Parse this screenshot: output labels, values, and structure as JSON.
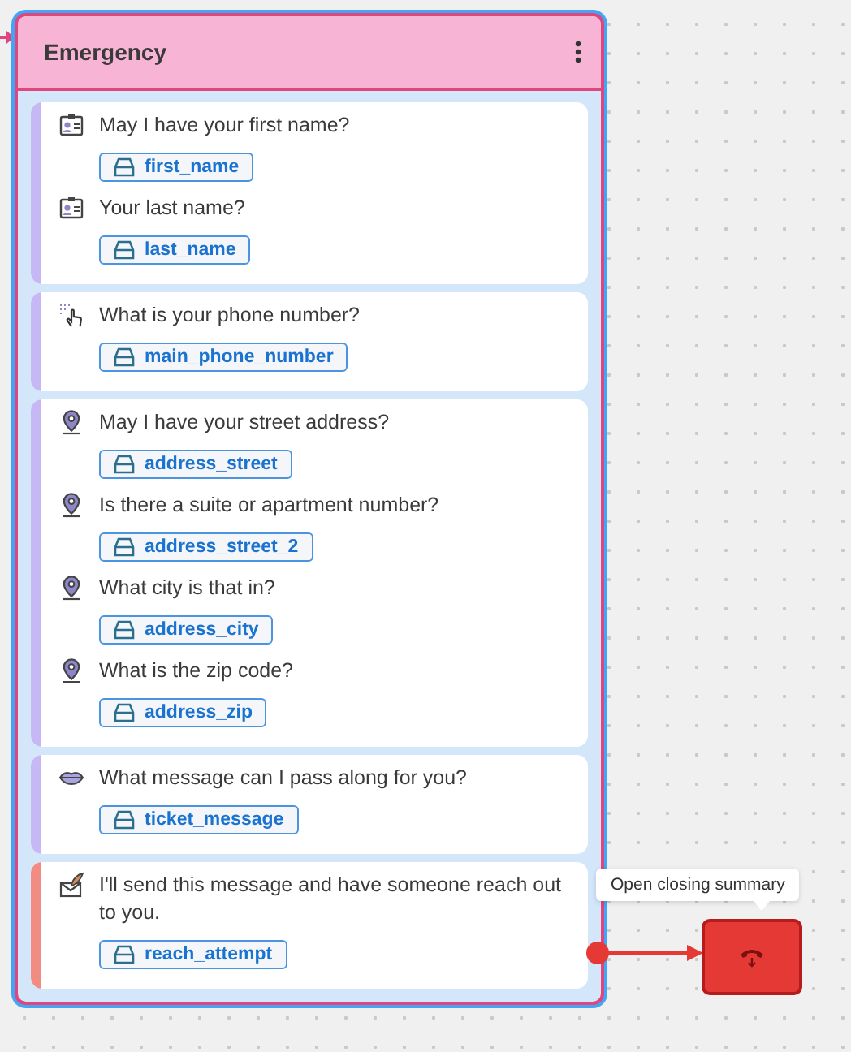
{
  "node": {
    "title": "Emergency",
    "groups": [
      {
        "color": "#c5b8f5",
        "questions": [
          {
            "kind": "contact",
            "text": "May I have your first name?",
            "variable": "first_name"
          },
          {
            "kind": "contact",
            "text": "Your last name?",
            "variable": "last_name"
          }
        ]
      },
      {
        "color": "#c5b8f5",
        "questions": [
          {
            "kind": "touch",
            "text": "What is your phone number?",
            "variable": "main_phone_number"
          }
        ]
      },
      {
        "color": "#c5b8f5",
        "questions": [
          {
            "kind": "location",
            "text": "May I have your street address?",
            "variable": "address_street"
          },
          {
            "kind": "location",
            "text": "Is there a suite or apartment number?",
            "variable": "address_street_2"
          },
          {
            "kind": "location",
            "text": "What city is that in?",
            "variable": "address_city"
          },
          {
            "kind": "location",
            "text": "What is the zip code?",
            "variable": "address_zip"
          }
        ]
      },
      {
        "color": "#c5b8f5",
        "questions": [
          {
            "kind": "lips",
            "text": "What message can I pass along for you?",
            "variable": "ticket_message"
          }
        ]
      },
      {
        "color": "#f28b82",
        "questions": [
          {
            "kind": "mail",
            "text": "I'll send this message and have someone reach out to you.",
            "variable": "reach_attempt"
          }
        ]
      }
    ]
  },
  "tooltip": "Open closing summary"
}
